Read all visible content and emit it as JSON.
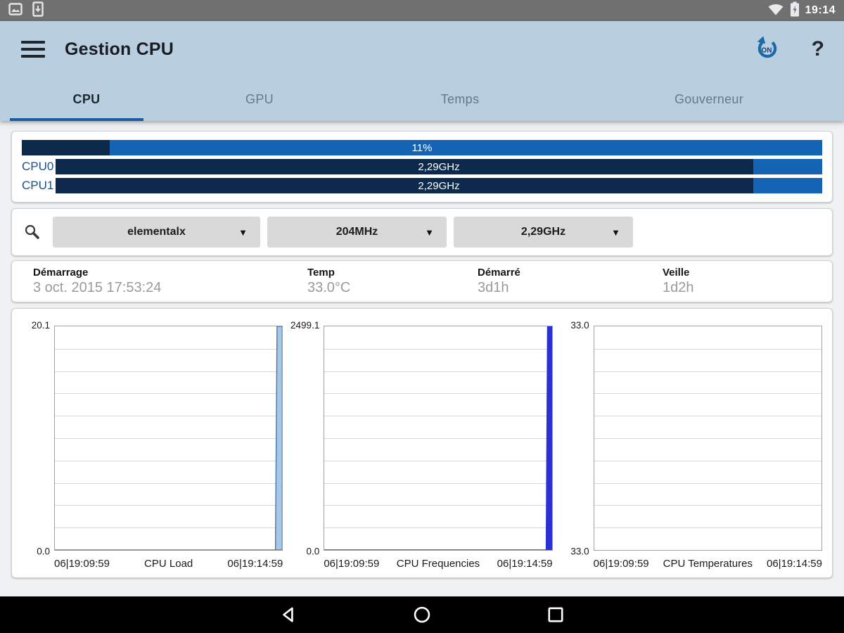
{
  "status_bar": {
    "time": "19:14",
    "left_icons": [
      "screenshot-icon",
      "usb-debug-icon"
    ],
    "right_icons": [
      "wifi-icon",
      "battery-charging-icon"
    ]
  },
  "app_bar": {
    "title": "Gestion CPU",
    "apply_on_boot_label": "ON",
    "help_label": "?"
  },
  "tabs": [
    {
      "label": "CPU",
      "active": true
    },
    {
      "label": "GPU",
      "active": false
    },
    {
      "label": "Temps",
      "active": false
    },
    {
      "label": "Gouverneur",
      "active": false
    }
  ],
  "usage_card": {
    "total": {
      "label": "11%",
      "percent": 11
    },
    "cores": [
      {
        "name": "CPU0",
        "value": "2,29GHz",
        "percent": 91
      },
      {
        "name": "CPU1",
        "value": "2,29GHz",
        "percent": 91
      }
    ]
  },
  "controls_card": {
    "governor": "elementalx",
    "min_freq": "204MHz",
    "max_freq": "2,29GHz",
    "dropdown_arrow": "▼"
  },
  "info_card": {
    "items": [
      {
        "label": "Démarrage",
        "value": "3 oct. 2015 17:53:24"
      },
      {
        "label": "Temp",
        "value": "33.0°C"
      },
      {
        "label": "Démarré",
        "value": "3d1h"
      },
      {
        "label": "Veille",
        "value": "1d2h"
      }
    ]
  },
  "chart_data": [
    {
      "type": "area",
      "title": "CPU Load",
      "ylim": [
        0.0,
        20.1
      ],
      "y_top_label": "20.1",
      "y_bottom_label": "0.0",
      "x_start_label": "06|19:09:59",
      "x_end_label": "06|19:14:59",
      "gridlines": 10,
      "legend": "none",
      "series": [
        {
          "name": "cpu-load",
          "fill": "#a9c7e4",
          "stroke": "#4878aa",
          "points": [
            [
              0,
              0
            ],
            [
              0.97,
              0
            ],
            [
              0.977,
              20.1
            ],
            [
              1,
              20.1
            ],
            [
              1,
              0
            ]
          ]
        }
      ]
    },
    {
      "type": "area",
      "title": "CPU Frequencies",
      "ylim": [
        0.0,
        2499.1
      ],
      "y_top_label": "2499.1",
      "y_bottom_label": "0.0",
      "x_start_label": "06|19:09:59",
      "x_end_label": "06|19:14:59",
      "gridlines": 10,
      "legend": "none",
      "series": [
        {
          "name": "cpu-frequency",
          "fill": "#2a30d4",
          "stroke": "#2a30d4",
          "points": [
            [
              0,
              0
            ],
            [
              0.976,
              0
            ],
            [
              0.982,
              2499.1
            ],
            [
              1,
              2499.1
            ],
            [
              1,
              0
            ]
          ]
        }
      ]
    },
    {
      "type": "area",
      "title": "CPU Temperatures",
      "ylim": [
        33.0,
        33.0
      ],
      "y_top_label": "33.0",
      "y_bottom_label": "33.0",
      "x_start_label": "06|19:09:59",
      "x_end_label": "06|19:14:59",
      "gridlines": 10,
      "legend": "none",
      "series": []
    }
  ],
  "nav_bar": {
    "icons": [
      "back-icon",
      "home-icon",
      "recents-icon"
    ]
  },
  "colors": {
    "status_bar_bg": "#707070",
    "app_bar_bg": "#b9cfe0",
    "tab_underline": "#1a5ca6",
    "bar_track": "#1463b4",
    "bar_fill": "#0d2a4d",
    "core_label": "#1a4e8c",
    "load_area_fill": "#a9c7e4",
    "load_area_stroke": "#4878aa",
    "freq_bar": "#2a30d4"
  }
}
